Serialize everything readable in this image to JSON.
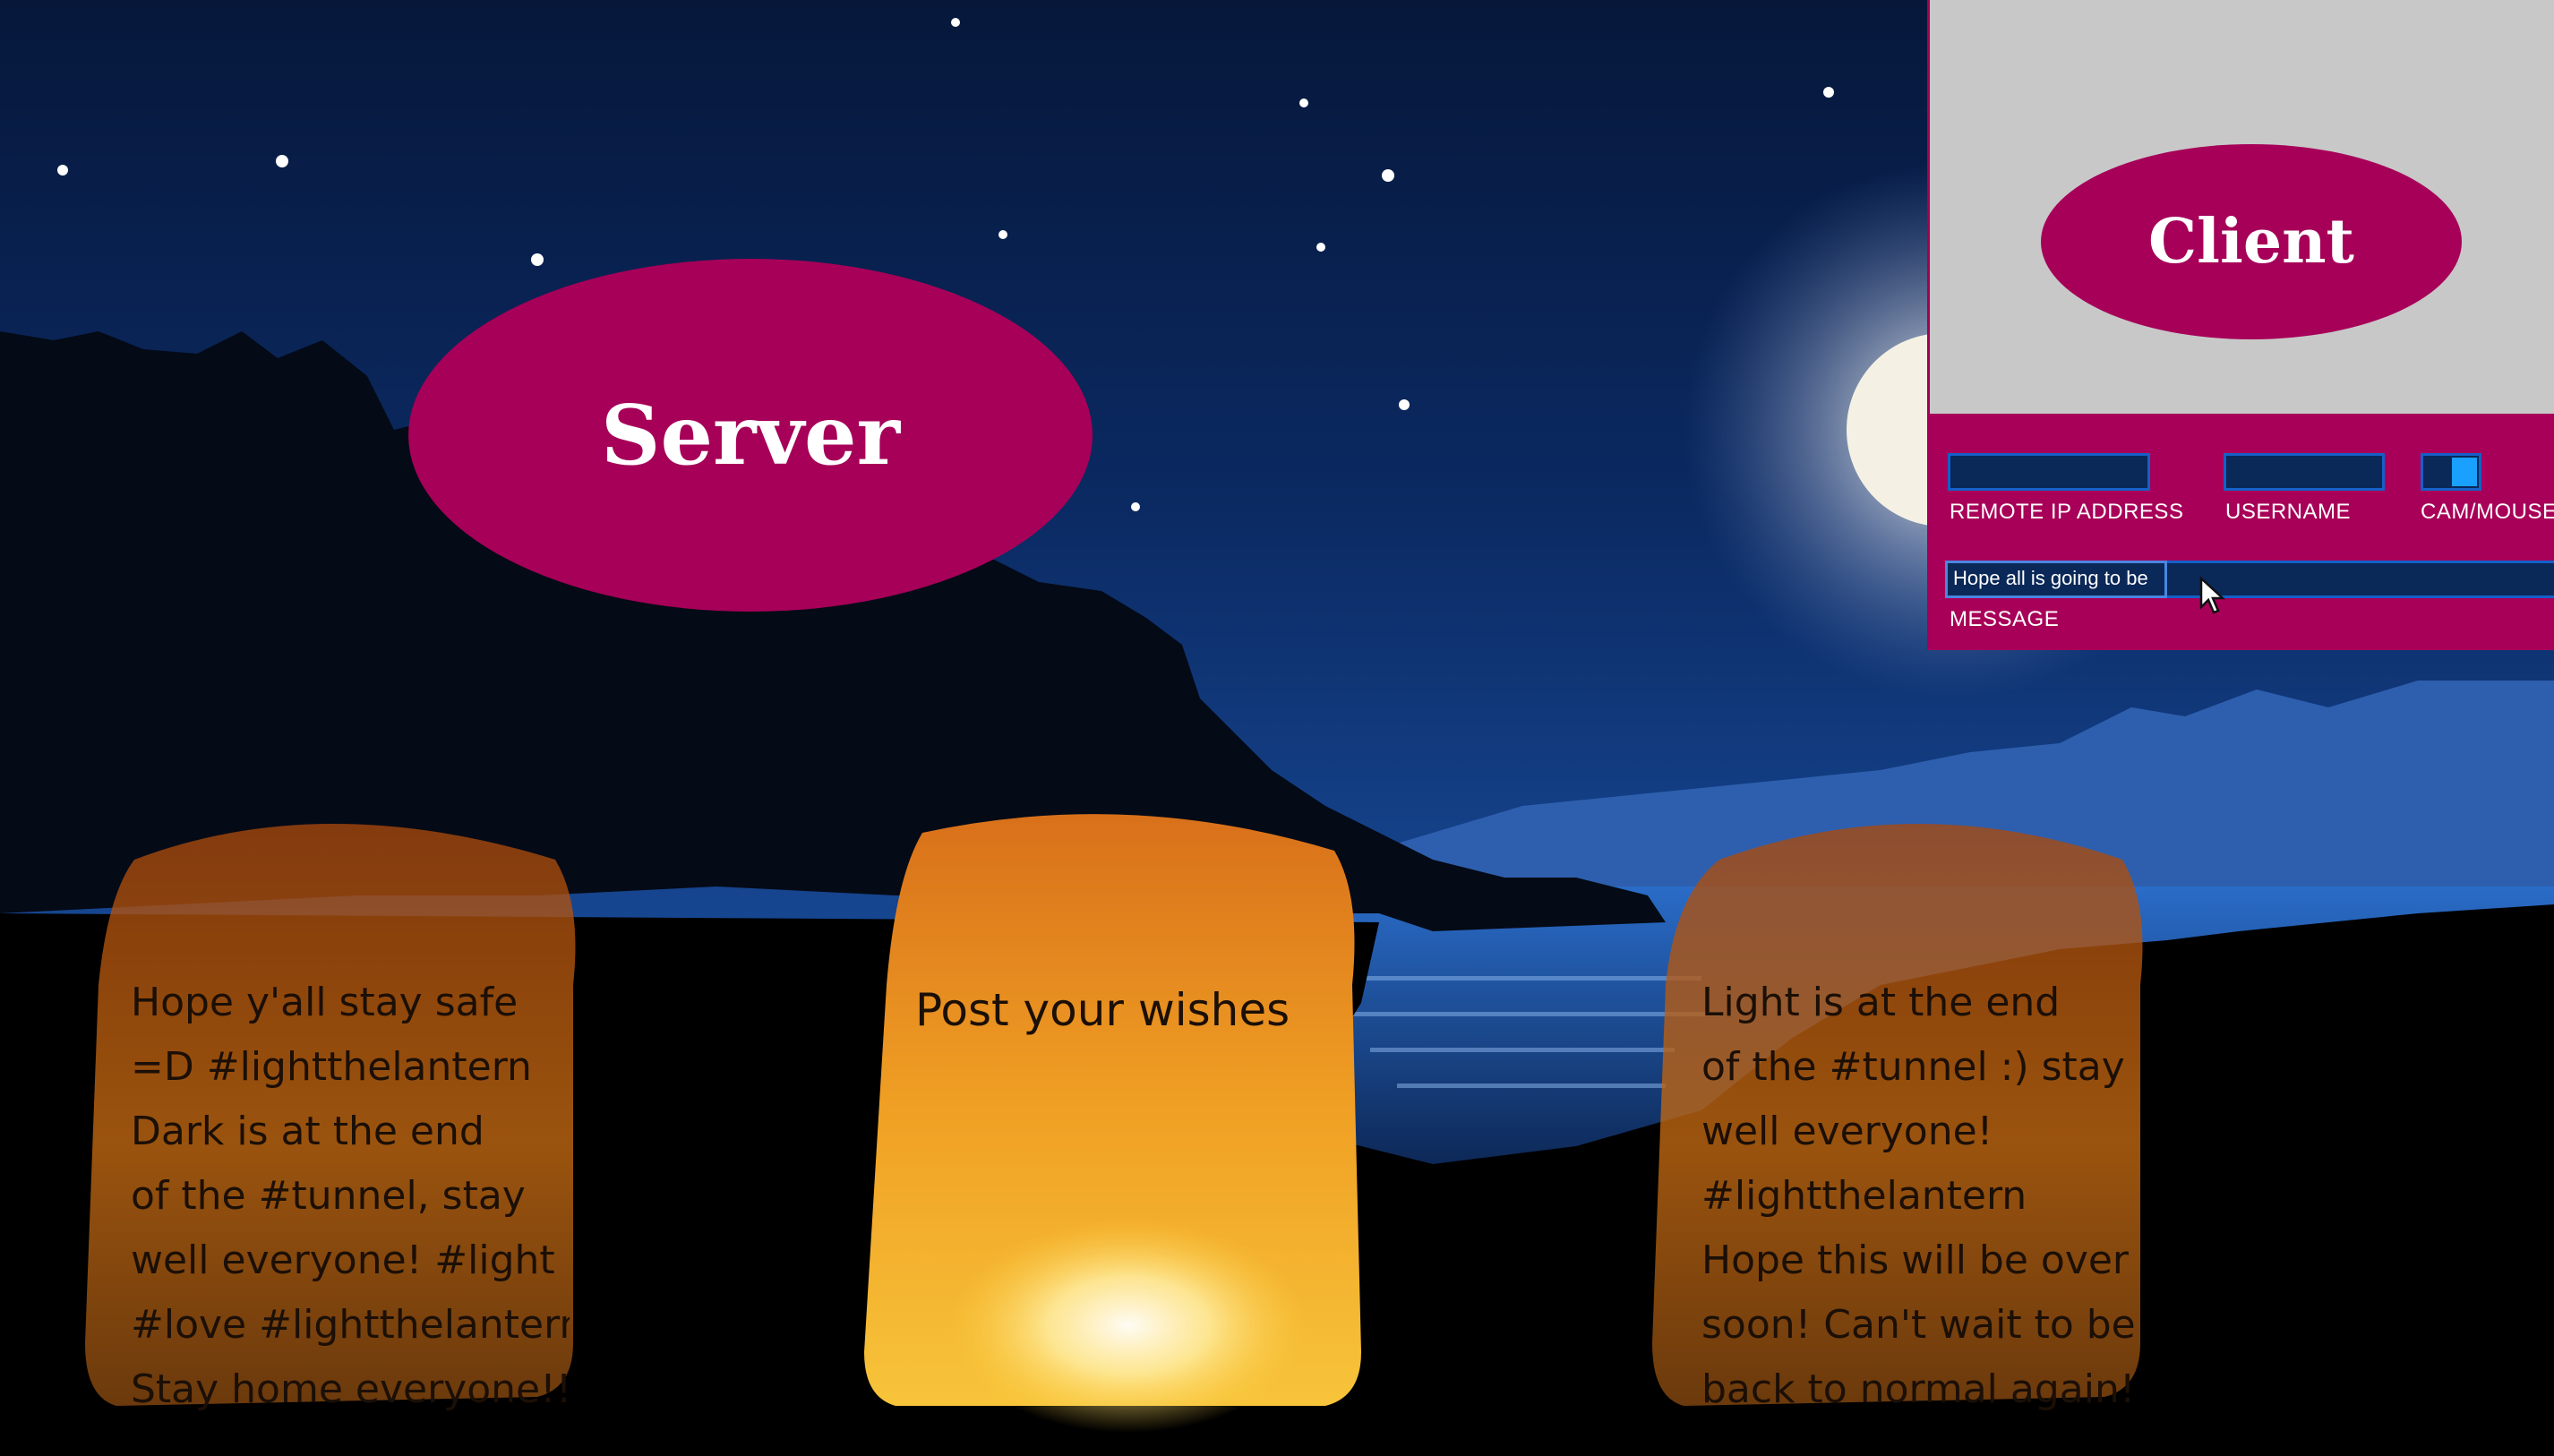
{
  "server": {
    "label": "Server"
  },
  "client": {
    "label": "Client"
  },
  "form": {
    "remote_ip_label": "REMOTE IP ADDRESS",
    "remote_ip_value": "",
    "username_label": "USERNAME",
    "username_value": "",
    "cam_mouse_label": "CAM/MOUSE",
    "message_label": "MESSAGE",
    "message_value": "Hope all is going to be"
  },
  "lanterns": [
    {
      "lines": [
        "Hope y'all stay safe",
        "=D #lightthelantern",
        "Dark is at the end",
        "of the #tunnel, stay",
        "well everyone! #light",
        "#love #lightthelantern",
        "Stay home everyone!!"
      ]
    },
    {
      "lines": [
        "Post your wishes"
      ]
    },
    {
      "lines": [
        "Light is at the end",
        "of the #tunnel :) stay",
        "well everyone!",
        "#lightthelantern",
        "Hope this will be over",
        "soon! Can't wait to be",
        "back to normal again!"
      ]
    }
  ],
  "colors": {
    "accent": "#a60058",
    "field": "#0a2858",
    "toggle_on": "#1aa0ff",
    "sky_top": "#06173a",
    "sky_mid": "#0c2f6c"
  }
}
